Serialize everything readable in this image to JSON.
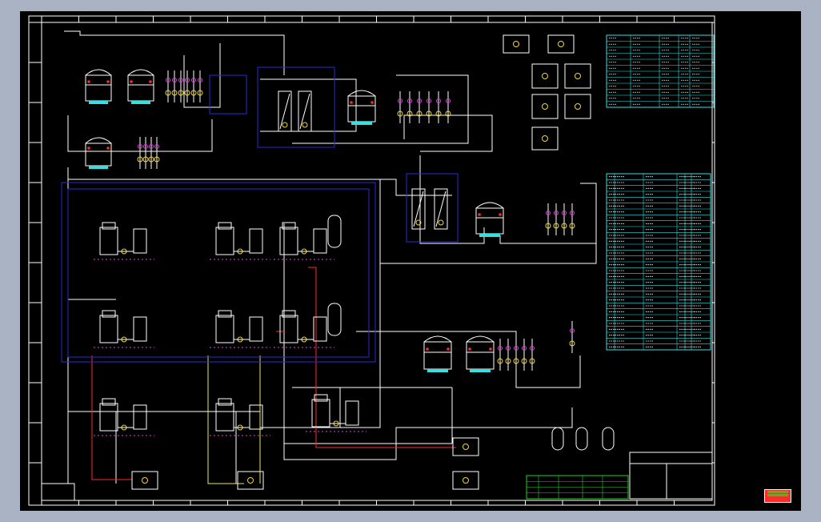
{
  "colors": {
    "background": "#000000",
    "outer": "#a9b3c4",
    "line": "#ffffff",
    "pipe_red": "#ff2a2a",
    "pipe_yellow": "#e8e85a",
    "pipe_blue": "#2a2ad8",
    "cyan": "#35e0e0",
    "magenta": "#e040e0",
    "yellow": "#f2d438",
    "green": "#23d123"
  },
  "icons": {
    "logo": "red-green-stamp-logo"
  }
}
